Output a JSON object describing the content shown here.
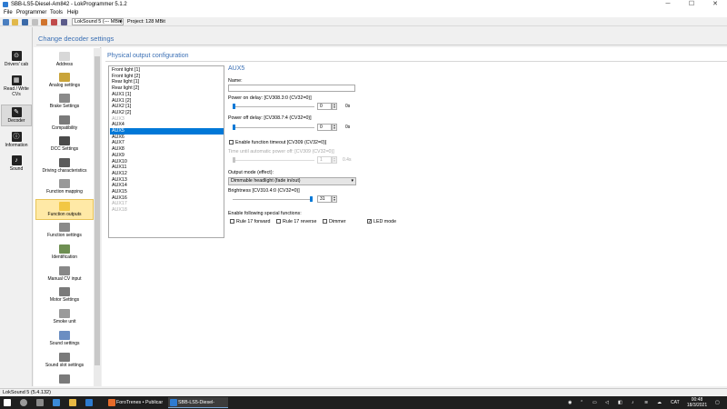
{
  "window": {
    "title": "SBB-LS5-Diesel-Am842 - LokProgrammer 5.1.2",
    "minimize": "─",
    "maximize": "☐",
    "close": "✕"
  },
  "menu": [
    "File",
    "Programmer",
    "Tools",
    "Help"
  ],
  "toolbar": {
    "decoder_select": "LokSound 5 (--- MBit)",
    "project_label": "Project:   128 MBit"
  },
  "leftnav": [
    {
      "label": "Drivers' cab",
      "icon": "steering-wheel-icon",
      "glyph": "⊙"
    },
    {
      "label": "Read / Write CVs",
      "icon": "cv-chip-icon",
      "glyph": "▦"
    },
    {
      "label": "Decoder",
      "icon": "decoder-icon",
      "glyph": "✎",
      "selected": true
    },
    {
      "label": "Information",
      "icon": "info-icon",
      "glyph": "ⓘ"
    },
    {
      "label": "Sound",
      "icon": "sound-icon",
      "glyph": "♪"
    }
  ],
  "header": {
    "title": "Change decoder settings"
  },
  "categories": [
    {
      "label": "Address",
      "icon": "envelope-icon",
      "color": "#d8d8d8"
    },
    {
      "label": "Analog settings",
      "icon": "analog-icon",
      "color": "#c9a43a"
    },
    {
      "label": "Brake Settings",
      "icon": "brake-icon",
      "color": "#8a8a8a"
    },
    {
      "label": "Compatibility",
      "icon": "compatibility-icon",
      "color": "#7a7a7a"
    },
    {
      "label": "DCC Settings",
      "icon": "dcc-icon",
      "color": "#4a4a4a"
    },
    {
      "label": "Driving characteristics",
      "icon": "sliders-icon",
      "color": "#5a5a5a"
    },
    {
      "label": "Function mapping",
      "icon": "function-mapping-icon",
      "color": "#999999"
    },
    {
      "label": "Function outputs",
      "icon": "bulb-icon",
      "color": "#f2c744",
      "selected": true
    },
    {
      "label": "Function settings",
      "icon": "function-settings-icon",
      "color": "#8a8a8a"
    },
    {
      "label": "Identification",
      "icon": "identification-icon",
      "color": "#6e8f52"
    },
    {
      "label": "Manual CV input",
      "icon": "pen-icon",
      "color": "#888888"
    },
    {
      "label": "Motor Settings",
      "icon": "motor-icon",
      "color": "#7a7a7a"
    },
    {
      "label": "Smoke unit",
      "icon": "smoke-icon",
      "color": "#9a9a9a"
    },
    {
      "label": "Sound settings",
      "icon": "sound-settings-icon",
      "color": "#6b8ec2"
    },
    {
      "label": "Sound slot settings",
      "icon": "sound-slot-icon",
      "color": "#7a7a7a"
    }
  ],
  "section": {
    "title": "Physical output configuration"
  },
  "outputs": [
    {
      "label": "Front light [1]"
    },
    {
      "label": "Front light [2]"
    },
    {
      "label": "Rear light [1]"
    },
    {
      "label": "Rear light [2]"
    },
    {
      "label": "AUX1 [1]"
    },
    {
      "label": "AUX1 [2]"
    },
    {
      "label": "AUX2 [1]"
    },
    {
      "label": "AUX2 [2]"
    },
    {
      "label": "AUX3",
      "dim": true
    },
    {
      "label": "AUX4"
    },
    {
      "label": "AUX5",
      "selected": true
    },
    {
      "label": "AUX6"
    },
    {
      "label": "AUX7"
    },
    {
      "label": "AUX8"
    },
    {
      "label": "AUX9"
    },
    {
      "label": "AUX10"
    },
    {
      "label": "AUX11"
    },
    {
      "label": "AUX12"
    },
    {
      "label": "AUX13"
    },
    {
      "label": "AUX14"
    },
    {
      "label": "AUX15"
    },
    {
      "label": "AUX16"
    },
    {
      "label": "AUX17",
      "dim": true
    },
    {
      "label": "AUX18",
      "dim": true
    }
  ],
  "detail": {
    "title": "AUX5",
    "name_label": "Name:",
    "name_value": "",
    "power_on_label": "Power on delay: [CV308.3:0 (CV32=0)]",
    "power_on_value": "0",
    "power_on_unit": "0s",
    "power_off_label": "Power off delay: [CV308.7:4 (CV32=0)]",
    "power_off_value": "0",
    "power_off_unit": "0s",
    "timeout_label": "Enable function timeout [CV309 (CV32=0)]",
    "timeout_checked": false,
    "auto_off_label": "Time until automatic power off: [CV309 (CV32=0)]",
    "auto_off_value": "1",
    "auto_off_unit": "0.4s",
    "mode_label": "Output mode (effect):",
    "mode_value": "Dimmable headlight (fade in/out)",
    "brightness_label": "Brightness [CV310.4:0 (CV32=0)]",
    "brightness_value": "31",
    "brightness_fraction": 1.0,
    "special_label": "Enable following special functions:",
    "special": [
      {
        "label": "Rule 17 forward",
        "checked": false
      },
      {
        "label": "Rule 17 reverse",
        "checked": false
      },
      {
        "label": "Dimmer",
        "checked": false
      },
      {
        "label": "LED mode",
        "checked": true
      }
    ]
  },
  "status": {
    "text": "LokSound 5 (5.4.132)"
  },
  "taskbar": {
    "apps": [
      {
        "label": "ForoTrenes • Publicar ...",
        "icon": "firefox-icon"
      },
      {
        "label": "SBB-LS5-Diesel-Am84...",
        "icon": "lokprogrammer-icon",
        "active": true
      }
    ],
    "language": "CAT",
    "time": "00:48",
    "date": "18/3/2021"
  }
}
